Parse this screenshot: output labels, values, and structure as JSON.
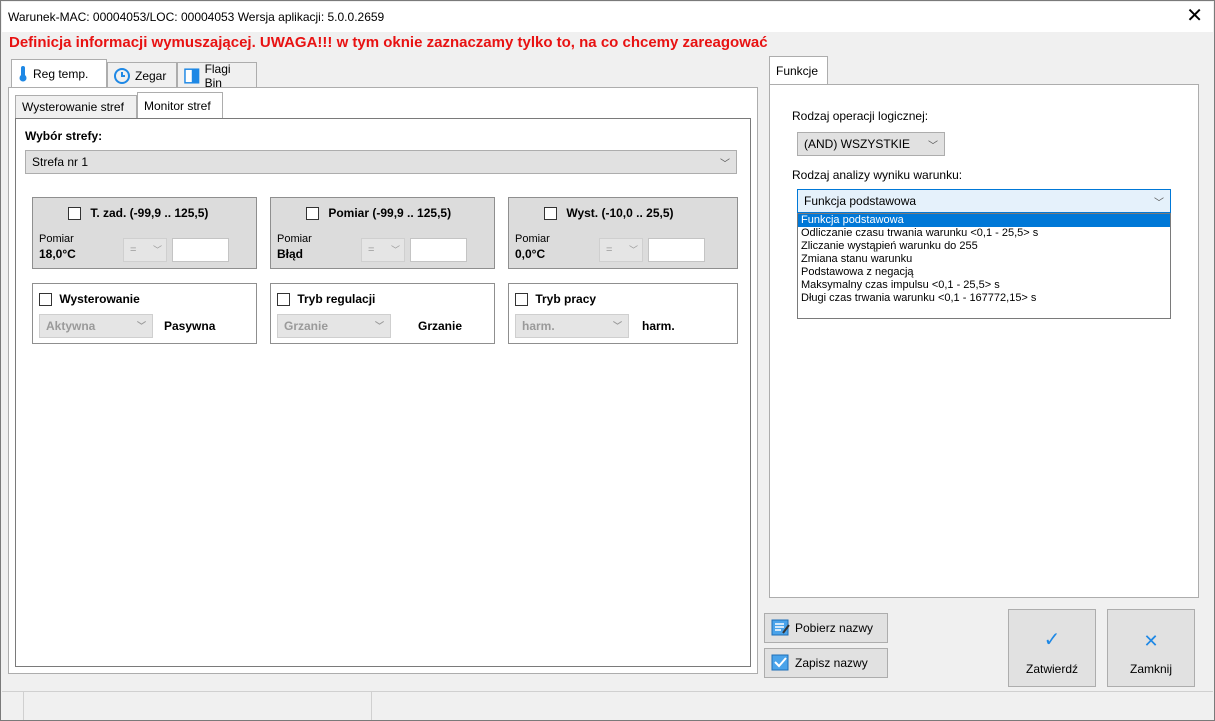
{
  "window": {
    "title": "Warunek-MAC: 00004053/LOC: 00004053 Wersja aplikacji: 5.0.0.2659",
    "close_icon": "close-icon"
  },
  "warning": "Definicja informacji wymuszającej. UWAGA!!! w tym oknie zaznaczamy tylko to, na co chcemy zareagować",
  "left_tabs": [
    {
      "label": "Reg temp.",
      "icon": "thermometer-icon",
      "selected": true
    },
    {
      "label": "Zegar",
      "icon": "clock-icon",
      "selected": false
    },
    {
      "label": "Flagi Bin",
      "icon": "flag-bin-icon",
      "selected": false
    }
  ],
  "sub_tabs": [
    {
      "label": "Wysterowanie stref",
      "selected": false
    },
    {
      "label": "Monitor stref",
      "selected": true
    }
  ],
  "zone": {
    "label": "Wybór strefy:",
    "selected": "Strefa nr 1"
  },
  "groups": [
    {
      "title": "T. zad. (-99,9 .. 125,5)",
      "sub_label": "Pomiar",
      "value": "18,0°C",
      "operator": "="
    },
    {
      "title": "Pomiar (-99,9 .. 125,5)",
      "sub_label": "Pomiar",
      "value": "Błąd",
      "operator": "="
    },
    {
      "title": "Wyst. (-10,0 .. 25,5)",
      "sub_label": "Pomiar",
      "value": "0,0°C",
      "operator": "="
    }
  ],
  "modes": [
    {
      "title": "Wysterowanie",
      "combo": "Aktywna",
      "value": "Pasywna"
    },
    {
      "title": "Tryb regulacji",
      "combo": "Grzanie",
      "value": "Grzanie"
    },
    {
      "title": "Tryb pracy",
      "combo": "harm.",
      "value": "harm."
    }
  ],
  "right_tab": {
    "label": "Funkcje"
  },
  "functions": {
    "logic_label": "Rodzaj operacji logicznej:",
    "logic_value": "(AND) WSZYSTKIE",
    "analysis_label": "Rodzaj analizy wyniku warunku:",
    "analysis_value": "Funkcja podstawowa",
    "options": [
      "Funkcja podstawowa",
      "Odliczanie czasu trwania warunku <0,1 - 25,5> s",
      "Zliczanie wystąpień warunku do 255",
      "Zmiana stanu warunku",
      "Podstawowa z negacją",
      "Maksymalny czas impulsu <0,1 - 25,5> s",
      "Długi czas trwania warunku <0,1 - 167772,15> s"
    ]
  },
  "buttons": {
    "fetch_names": "Pobierz nazwy",
    "save_names": "Zapisz nazwy",
    "confirm": "Zatwierdź",
    "close": "Zamknij"
  },
  "colors": {
    "warning": "#e81212",
    "highlight": "#0078d7",
    "accent_icon": "#1e88e5"
  }
}
